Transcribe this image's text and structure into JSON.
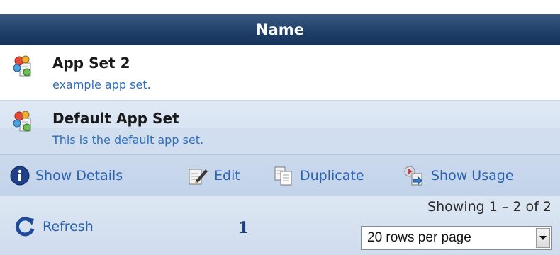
{
  "table": {
    "header": "Name",
    "rows": [
      {
        "title": "App Set 2",
        "description": "example app set.",
        "icon": "app-set-icon"
      },
      {
        "title": "Default App Set",
        "description": "This is the default app set.",
        "icon": "app-set-icon"
      }
    ]
  },
  "actions": {
    "show_details": "Show Details",
    "edit": "Edit",
    "duplicate": "Duplicate",
    "show_usage": "Show Usage"
  },
  "footer": {
    "refresh": "Refresh",
    "page": "1",
    "showing": "Showing 1 – 2 of 2",
    "rows_per_page": "20 rows per page"
  },
  "colors": {
    "header_bg": "#20406a",
    "link": "#2a62b0",
    "description": "#2d6fbf"
  }
}
